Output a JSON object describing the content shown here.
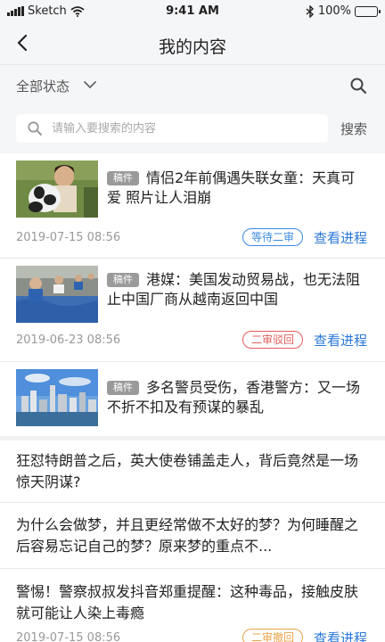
{
  "status_bar": {
    "carrier": "Sketch",
    "time": "9:41 AM",
    "battery": "100%",
    "battery_level": 1.0
  },
  "nav": {
    "title": "我的内容",
    "back_icon": "chevron-left-icon"
  },
  "filter": {
    "label": "全部状态",
    "chevron_icon": "chevron-down-icon",
    "search_icon": "search-icon"
  },
  "search": {
    "placeholder": "请输入要搜索的内容",
    "button": "搜索"
  },
  "colors": {
    "link": "#2b78d9",
    "pending": "#3c8ae0",
    "rejected": "#e25b5b",
    "withdrawn": "#e8a34a",
    "tag": "#9a9a9a"
  },
  "items": [
    {
      "tag": "稿件",
      "title": "情侣2年前偶遇失联女童：天真可爱 照片让人泪崩",
      "date": "2019-07-15 08:56",
      "status": "等待二审",
      "action": "查看进程"
    },
    {
      "tag": "稿件",
      "title": "港媒：美国发动贸易战，也无法阻止中国厂商从越南返回中国",
      "date": "2019-06-23 08:56",
      "status": "二审驳回",
      "action": "查看进程"
    },
    {
      "tag": "稿件",
      "title": "多名警员受伤，香港警方：又一场不折不扣及有预谋的暴乱"
    },
    {
      "title": "狂怼特朗普之后，英大使卷铺盖走人，背后竟然是一场惊天阴谋?"
    },
    {
      "title": "为什么会做梦，并且更经常做不太好的梦？为何睡醒之后容易忘记自己的梦？原来梦的重点不..."
    },
    {
      "title": "警惕！警察叔叔发抖音郑重提醒：这种毒品，接触皮肤就可能让人染上毒瘾",
      "date": "2019-07-15 08:56",
      "status": "二审撤回",
      "action": "查看进程"
    }
  ]
}
